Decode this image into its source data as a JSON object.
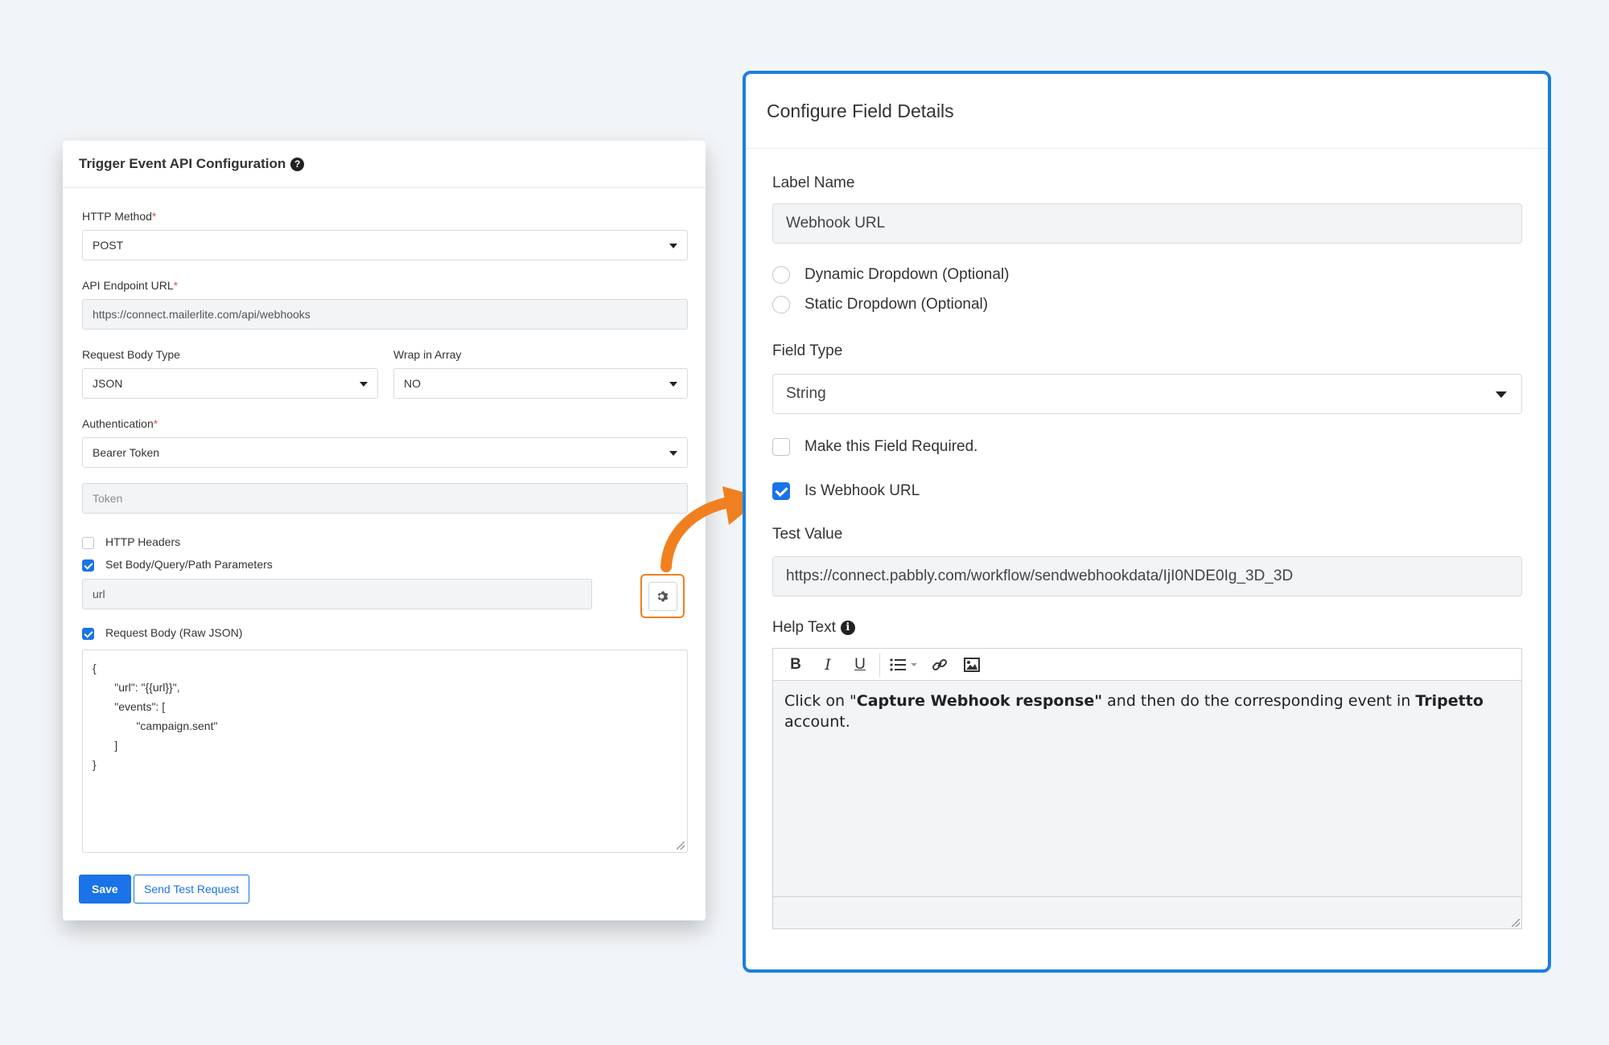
{
  "left": {
    "title": "Trigger Event API Configuration",
    "help_icon": "question-circle-icon",
    "http_method": {
      "label": "HTTP Method",
      "value": "POST"
    },
    "api_endpoint": {
      "label": "API Endpoint URL",
      "value": "https://connect.mailerlite.com/api/webhooks"
    },
    "request_body_type": {
      "label": "Request Body Type",
      "value": "JSON"
    },
    "wrap_in_array": {
      "label": "Wrap in Array",
      "value": "NO"
    },
    "authentication": {
      "label": "Authentication",
      "value": "Bearer Token"
    },
    "token": {
      "placeholder": "Token"
    },
    "http_headers": {
      "label": "HTTP Headers",
      "checked": false
    },
    "set_params": {
      "label": "Set Body/Query/Path Parameters",
      "checked": true
    },
    "param_value": "url",
    "request_body": {
      "label": "Request Body (Raw JSON)",
      "checked": true
    },
    "json_body": "{\n       \"url\": \"{{url}}\",\n       \"events\": [\n              \"campaign.sent\"\n       ]\n}",
    "save_label": "Save",
    "test_label": "Send Test Request",
    "required_mark": "*"
  },
  "right": {
    "title": "Configure Field Details",
    "label_name": {
      "label": "Label Name",
      "value": "Webhook URL"
    },
    "dynamic_dropdown": "Dynamic Dropdown (Optional)",
    "static_dropdown": "Static Dropdown (Optional)",
    "field_type": {
      "label": "Field Type",
      "value": "String"
    },
    "make_required": {
      "label": "Make this Field Required.",
      "checked": false
    },
    "is_webhook": {
      "label": "Is Webhook URL",
      "checked": true
    },
    "test_value": {
      "label": "Test Value",
      "value": "https://connect.pabbly.com/workflow/sendwebhookdata/IjI0NDE0Ig_3D_3D"
    },
    "help_text": {
      "label": "Help Text",
      "part1": "Click on \"",
      "bold1": "Capture Webhook response\"",
      "part2": " and then do the corresponding event in ",
      "bold2": "Tripetto",
      "part3": " account."
    }
  },
  "colors": {
    "accent": "#1a73e8",
    "highlight": "#f0801f",
    "card_border": "#1a7fe0"
  }
}
